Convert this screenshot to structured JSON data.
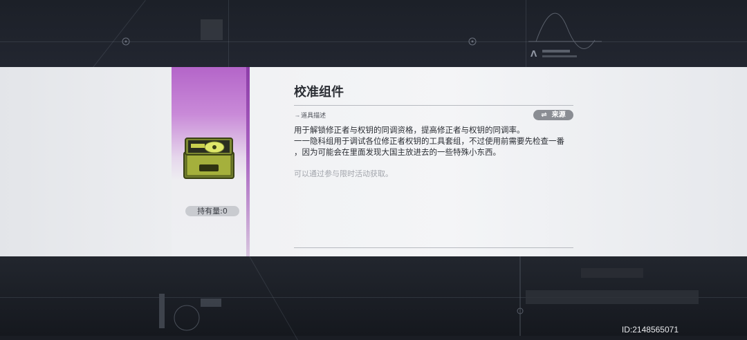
{
  "item": {
    "name": "校准组件",
    "holding_label": "持有量:0",
    "rarity_color": "#b465c9"
  },
  "description": {
    "section_label": "道具描述",
    "source_button": "来源",
    "lines": [
      "用于解锁修正者与权钥的同调资格，提高修正者与权钥的同调率。",
      "一一隐科组用于调试各位修正者权钥的工具套组，不过使用前需要先检查一番",
      "，因为可能会在里面发现大国主放进去的一些特殊小东西。"
    ],
    "acquire": "可以通过参与限时活动获取。"
  },
  "watermark": {
    "id": "ID:2148565071"
  },
  "icons": {
    "source": "swap-arrows-icon",
    "item": "toolbox-icon"
  }
}
